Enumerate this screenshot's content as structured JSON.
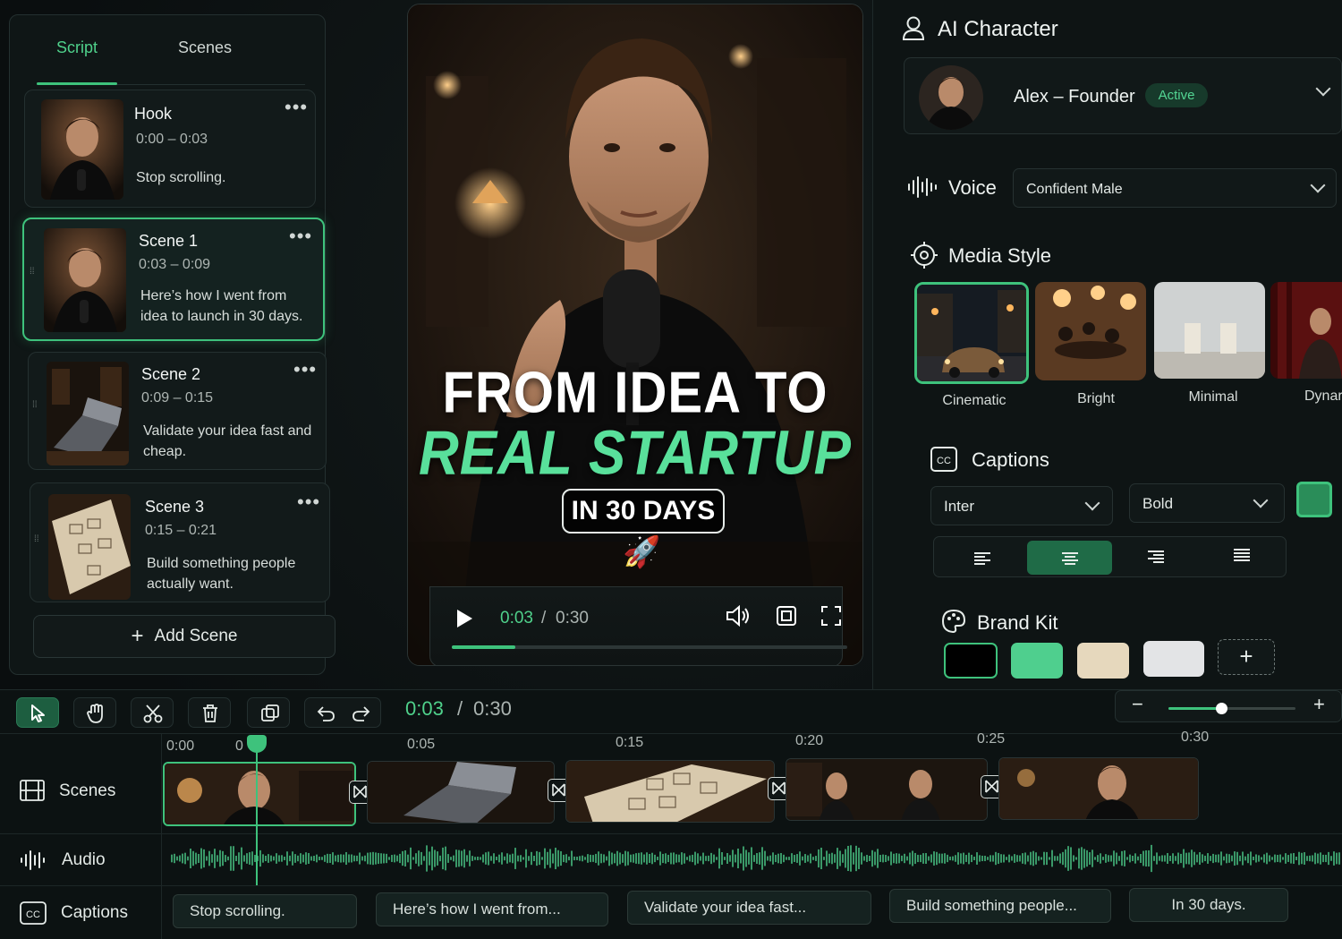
{
  "left_panel": {
    "tabs": [
      "Script",
      "Scenes"
    ],
    "scenes": [
      {
        "title": "Hook",
        "time": "0:00 – 0:03",
        "desc": "Stop scrolling."
      },
      {
        "title": "Scene 1",
        "time": "0:03 – 0:09",
        "desc": "Here’s how I went from idea to launch in 30 days."
      },
      {
        "title": "Scene 2",
        "time": "0:09 – 0:15",
        "desc": "Validate your idea fast and cheap."
      },
      {
        "title": "Scene 3",
        "time": "0:15 – 0:21",
        "desc": "Build something people actually want."
      }
    ],
    "add_scene": "Add Scene"
  },
  "video": {
    "line1": "FROM IDEA TO",
    "line2": "REAL STARTUP",
    "line3": "IN 30 DAYS",
    "current": "0:03",
    "separator": "/",
    "total": "0:30",
    "progress": 0.16
  },
  "right_panel": {
    "ai_character": {
      "title": "AI Character",
      "name": "Alex – Founder",
      "status": "Active"
    },
    "voice": {
      "title": "Voice",
      "value": "Confident Male"
    },
    "media_style": {
      "title": "Media Style",
      "options": [
        "Cinematic",
        "Bright",
        "Minimal",
        "Dynar"
      ],
      "selected": "Cinematic"
    },
    "captions": {
      "title": "Captions",
      "font": "Inter",
      "weight": "Bold",
      "color": "#2fa86a",
      "alignment_selected": "center"
    },
    "brand_kit": {
      "title": "Brand Kit",
      "colors": [
        "#000000",
        "#4fcf8e",
        "#e6d8bd",
        "#e3e4e6"
      ]
    }
  },
  "timeline": {
    "current": "0:03",
    "separator": "/",
    "total": "0:30",
    "ruler": [
      "0:00",
      "0",
      "0:05",
      "0:15",
      "0:20",
      "0:25",
      "0:30"
    ],
    "tracks": {
      "scenes": "Scenes",
      "audio": "Audio",
      "captions": "Captions"
    },
    "captions": [
      "Stop scrolling.",
      "Here’s how I went from...",
      "Validate your idea fast...",
      "Build something people...",
      "In 30 days."
    ]
  },
  "colors": {
    "accent": "#3ec27c",
    "accent_text": "#4fd18b",
    "bg": "#0b1011"
  }
}
